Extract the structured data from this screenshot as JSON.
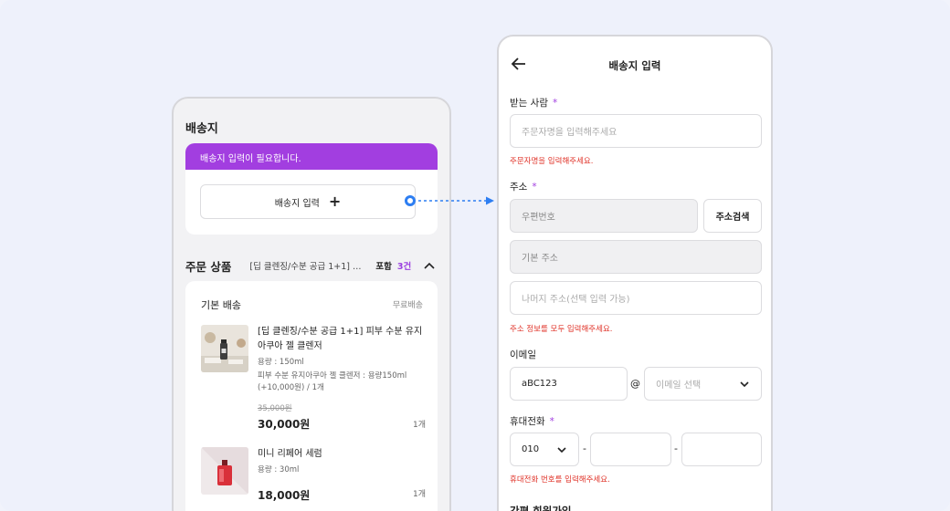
{
  "left_phone": {
    "title": "배송지",
    "notice": "배송지 입력이 필요합니다.",
    "address_button": "배송지 입력",
    "address_button_plus": "+",
    "order": {
      "title": "주문 상품",
      "summary": "[딥 클렌징/수분 공급 1+1] 피...",
      "include_label": "포함",
      "count": "3건"
    },
    "items_card": {
      "ship_type": "기본 배송",
      "ship_fee": "무료배송",
      "products": [
        {
          "name": "[딥 클렌징/수분 공급 1+1] 피부 수분 유지 아쿠아 젤 클렌저",
          "option1": "용량 : 150ml",
          "option2": "피부 수분 유지아쿠아 젤 클렌저 : 용량150ml (+10,000원) / 1개",
          "old_price": "35,000원",
          "price": "30,000원",
          "qty": "1개"
        },
        {
          "name": "미니 리페어 세럼",
          "option1": "용량 : 30ml",
          "price": "18,000원",
          "qty": "1개"
        }
      ]
    }
  },
  "right_phone": {
    "title": "배송지 입력",
    "recipient_label": "받는 사람",
    "required_mark": "*",
    "recipient_placeholder": "주문자명을 입력해주세요",
    "recipient_error": "주문자명을 입력해주세요.",
    "address_label": "주소",
    "zipcode_placeholder": "우편번호",
    "address_search": "주소검색",
    "base_address_placeholder": "기본 주소",
    "detail_address_placeholder": "나머지 주소(선택 입력 가능)",
    "address_error": "주소 정보를 모두 입력해주세요.",
    "email_label": "이메일",
    "email_id": "aBC123",
    "email_at": "@",
    "email_domain_placeholder": "이메일 선택",
    "phone_label": "휴대전화",
    "phone_prefix": "010",
    "phone_dash": "-",
    "phone_error": "휴대전화 번호를 입력해주세요.",
    "signup_title": "간편 회원가입"
  },
  "colors": {
    "accent_purple": "#a23ee0",
    "connector_blue": "#2d7ef2",
    "error_red": "#e0352b"
  }
}
